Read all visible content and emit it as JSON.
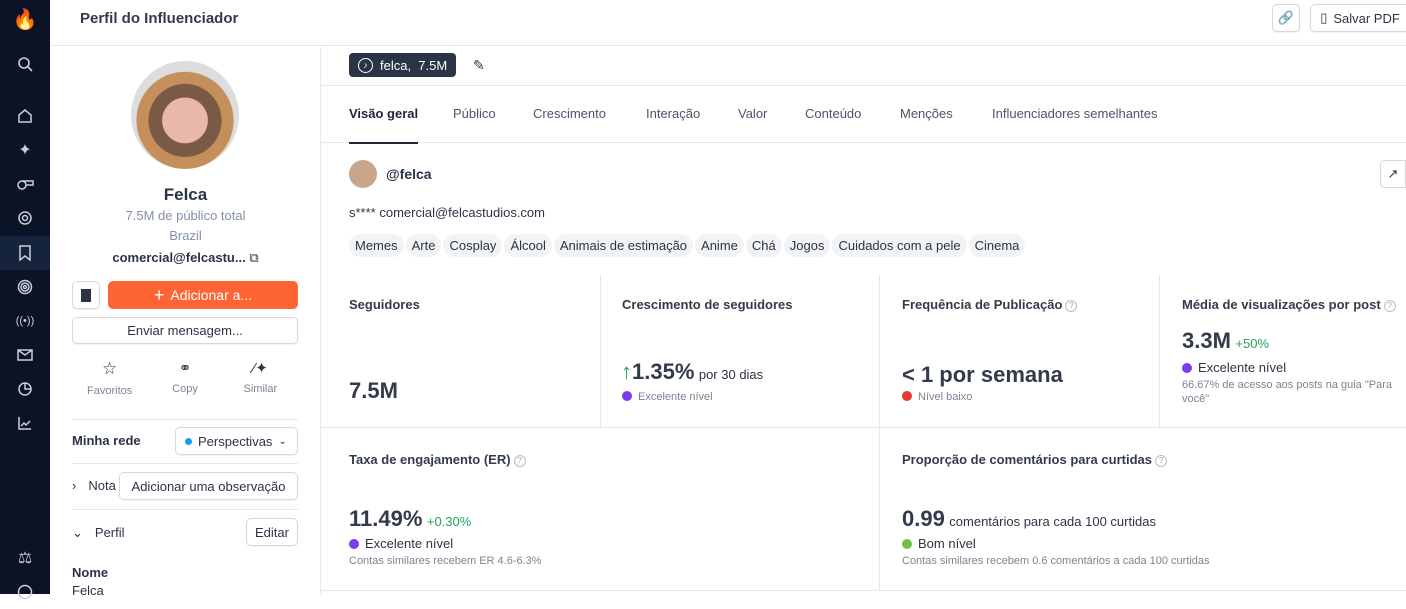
{
  "header": {
    "title": "Perfil do Influenciador",
    "save_pdf": "Salvar PDF"
  },
  "profile": {
    "name": "Felca",
    "audience": "7.5M de público total",
    "country": "Brazil",
    "email_short": "comercial@felcastu...",
    "add_button": "Adicionar a...",
    "message_button": "Enviar mensagem...",
    "actions": [
      {
        "label": "Favoritos",
        "icon": "star-icon"
      },
      {
        "label": "Copy",
        "icon": "link-icon"
      },
      {
        "label": "Similar",
        "icon": "magic-wand-icon"
      }
    ],
    "network_label": "Minha rede",
    "network_value": "Perspectivas",
    "notes_label": "Nota",
    "add_note": "Adicionar uma observação",
    "profile_section": "Perfil",
    "edit": "Editar",
    "name_label": "Nome",
    "name_value": "Felca"
  },
  "account_chip": {
    "label": "felca,  7.5M"
  },
  "tabs": [
    "Visão geral",
    "Público",
    "Crescimento",
    "Interação",
    "Valor",
    "Conteúdo",
    "Menções",
    "Influenciadores semelhantes"
  ],
  "account": {
    "handle": "@felca",
    "email": "s**** comercial@felcastudios.com",
    "tags": [
      "Memes",
      "Arte",
      "Cosplay",
      "Álcool",
      "Animais de estimação",
      "Anime",
      "Chá",
      "Jogos",
      "Cuidados com a pele",
      "Cinema"
    ]
  },
  "metrics": {
    "followers": {
      "label": "Seguidores",
      "value": "7.5M"
    },
    "growth": {
      "label": "Crescimento de seguidores",
      "arrow": "↑",
      "value": "1.35%",
      "suffix": "por 30 dias",
      "level": "Excelente nível"
    },
    "frequency": {
      "label": "Frequência de Publicação",
      "value": "< 1 por semana",
      "level": "Nível baixo"
    },
    "views": {
      "label": "Média de visualizações por post",
      "value": "3.3M",
      "change": "+50%",
      "level": "Excelente nível",
      "note": "66.67% de acesso aos posts na guia \"Para você\""
    },
    "er": {
      "label": "Taxa de engajamento (ER)",
      "value": "11.49%",
      "change": "+0.30%",
      "level": "Excelente nível",
      "note": "Contas similares recebem ER 4.6-6.3%"
    },
    "ratio": {
      "label": "Proporção de comentários para curtidas",
      "value": "0.99",
      "suffix": "comentários para cada 100 curtidas",
      "level": "Bom nível",
      "note": "Contas similares recebem 0.6 comentários a cada 100 curtidas"
    }
  },
  "colors": {
    "accent": "#ff6534",
    "purple": "#7c3aed",
    "red": "#e53935",
    "green": "#6cc04a",
    "blue": "#1a9bf0"
  }
}
